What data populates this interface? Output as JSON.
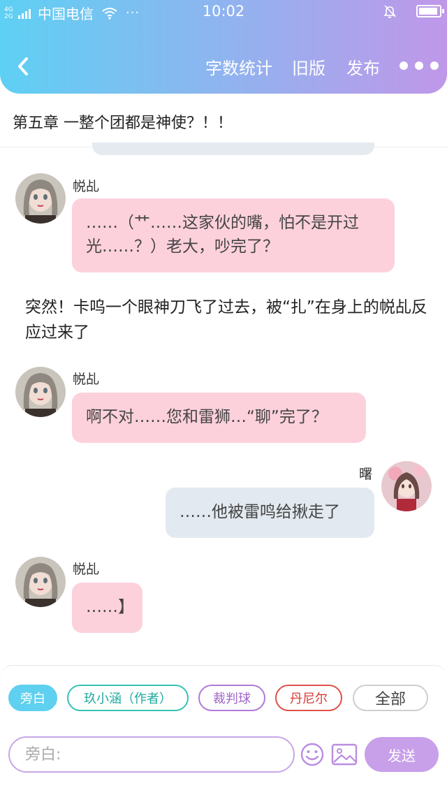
{
  "status_bar": {
    "network_type": "4G 2G",
    "carrier": "中国电信",
    "more": "···",
    "time": "10:02"
  },
  "header": {
    "word_count": "字数统计",
    "old_version": "旧版",
    "publish": "发布"
  },
  "chapter_title": "第五章  一整个团都是神使？！！",
  "messages": [
    {
      "sender": "帨乩",
      "text": "……（艹……这家伙的嘴，怕不是开过光……？）老大，吵完了？"
    },
    {
      "narration": "突然！卡呜一个眼神刀飞了过去，被“扎”在身上的帨乩反应过来了"
    },
    {
      "sender": "帨乩",
      "text": "啊不对……您和雷狮…“聊”完了？"
    },
    {
      "sender": "曙",
      "text": "……他被雷鸣给揪走了"
    },
    {
      "sender": "帨乩",
      "text": "……】"
    }
  ],
  "roles": {
    "narration": "旁白",
    "author": "玖小涵（作者）",
    "referee": "裁判球",
    "danier": "丹尼尔",
    "all": "全部"
  },
  "composer": {
    "placeholder": "旁白:",
    "send": "发送"
  },
  "colors": {
    "header_gradient_start": "#5ed0f3",
    "header_gradient_end": "#c097e9",
    "pink_bubble": "#fdd1dc",
    "gray_bubble": "#e2e9f0",
    "send_button": "#c8a0ea"
  }
}
